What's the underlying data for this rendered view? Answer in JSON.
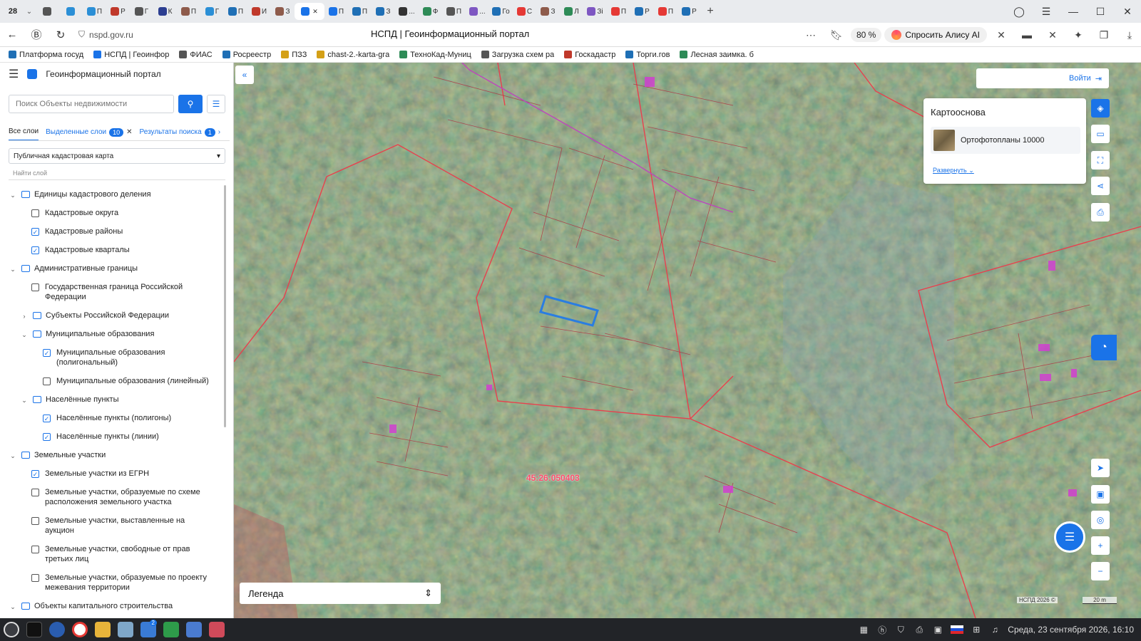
{
  "browser": {
    "tab_count": "28",
    "tabs": [
      {
        "label": "",
        "color": "#555"
      },
      {
        "label": "",
        "color": "#2b8fd6"
      },
      {
        "label": "П",
        "color": "#2b8fd6"
      },
      {
        "label": "Р",
        "color": "#c0392b"
      },
      {
        "label": "Г",
        "color": "#555"
      },
      {
        "label": "К",
        "color": "#2c3e91"
      },
      {
        "label": "П",
        "color": "#8e5b4b"
      },
      {
        "label": "Г",
        "color": "#2b8fd6"
      },
      {
        "label": "П",
        "color": "#1f6fb5"
      },
      {
        "label": "И",
        "color": "#c0392b"
      },
      {
        "label": "З",
        "color": "#8e5b4b"
      },
      {
        "label": "",
        "color": "#1a73e8",
        "active": true
      },
      {
        "label": "П",
        "color": "#1a73e8"
      },
      {
        "label": "П",
        "color": "#1f6fb5"
      },
      {
        "label": "З",
        "color": "#1f6fb5"
      },
      {
        "label": "...",
        "color": "#333"
      },
      {
        "label": "Ф",
        "color": "#2e8b57"
      },
      {
        "label": "П",
        "color": "#555"
      },
      {
        "label": "...",
        "color": "#7e57c2"
      },
      {
        "label": "Го",
        "color": "#1f6fb5"
      },
      {
        "label": "С",
        "color": "#e53935"
      },
      {
        "label": "З",
        "color": "#8e5b4b"
      },
      {
        "label": "Л",
        "color": "#2e8b57"
      },
      {
        "label": "Зі",
        "color": "#7e57c2"
      },
      {
        "label": "П",
        "color": "#e53935"
      },
      {
        "label": "Р",
        "color": "#1f6fb5"
      },
      {
        "label": "П",
        "color": "#e53935"
      },
      {
        "label": "Р",
        "color": "#1f6fb5"
      }
    ],
    "url": "nspd.gov.ru",
    "page_title": "НСПД | Геоинформационный портал",
    "zoom": "80 %",
    "alice": "Спросить Алису AI",
    "bookmarks": [
      {
        "label": "Платформа госуд",
        "color": "#1f6fb5"
      },
      {
        "label": "НСПД | Геоинфор",
        "color": "#1a73e8"
      },
      {
        "label": "ФИАС",
        "color": "#555"
      },
      {
        "label": "Росреестр",
        "color": "#1f6fb5"
      },
      {
        "label": "ПЗЗ",
        "color": "#d4a017"
      },
      {
        "label": "chast-2.-karta-gra",
        "color": "#d4a017"
      },
      {
        "label": "ТехноКад-Муниц",
        "color": "#2e8b57"
      },
      {
        "label": "Загрузка схем ра",
        "color": "#555"
      },
      {
        "label": "Госкадастр",
        "color": "#c0392b"
      },
      {
        "label": "Торги.гов",
        "color": "#1f6fb5"
      },
      {
        "label": "Лесная заимка. б",
        "color": "#2e8b57"
      }
    ]
  },
  "sidebar": {
    "title": "Геоинформационный портал",
    "search_placeholder": "Поиск Объекты недвижимости",
    "tabs": {
      "all": "Все слои",
      "selected": "Выделенные слои",
      "selected_count": "10",
      "results": "Результаты поиска",
      "results_count": "1"
    },
    "map_select": "Публичная кадастровая карта",
    "find_layer": "Найти слой",
    "tree": [
      {
        "type": "folder",
        "level": 0,
        "expanded": true,
        "label": "Единицы кадастрового деления"
      },
      {
        "type": "check",
        "level": 1,
        "checked": false,
        "label": "Кадастровые округа"
      },
      {
        "type": "check",
        "level": 1,
        "checked": true,
        "label": "Кадастровые районы"
      },
      {
        "type": "check",
        "level": 1,
        "checked": true,
        "label": "Кадастровые кварталы"
      },
      {
        "type": "folder",
        "level": 0,
        "expanded": true,
        "label": "Административные границы"
      },
      {
        "type": "check",
        "level": 1,
        "checked": false,
        "label": "Государственная граница Российской Федерации"
      },
      {
        "type": "folder",
        "level": 1,
        "expanded": false,
        "label": "Субъекты Российской Федерации"
      },
      {
        "type": "folder",
        "level": 1,
        "expanded": true,
        "label": "Муниципальные образования"
      },
      {
        "type": "check",
        "level": 2,
        "checked": true,
        "label": "Муниципальные образования (полигональный)"
      },
      {
        "type": "check",
        "level": 2,
        "checked": false,
        "label": "Муниципальные образования (линейный)"
      },
      {
        "type": "folder",
        "level": 1,
        "expanded": true,
        "label": "Населённые пункты"
      },
      {
        "type": "check",
        "level": 2,
        "checked": true,
        "label": "Населённые пункты (полигоны)"
      },
      {
        "type": "check",
        "level": 2,
        "checked": true,
        "label": "Населённые пункты (линии)"
      },
      {
        "type": "folder",
        "level": 0,
        "expanded": true,
        "label": "Земельные участки"
      },
      {
        "type": "check",
        "level": 1,
        "checked": true,
        "label": "Земельные участки из ЕГРН"
      },
      {
        "type": "check",
        "level": 1,
        "checked": false,
        "label": "Земельные участки, образуемые по схеме расположения земельного участка"
      },
      {
        "type": "check",
        "level": 1,
        "checked": false,
        "label": "Земельные участки, выставленные на аукцион"
      },
      {
        "type": "check",
        "level": 1,
        "checked": false,
        "label": "Земельные участки, свободные от прав третьих лиц"
      },
      {
        "type": "check",
        "level": 1,
        "checked": false,
        "label": "Земельные участки, образуемые по проекту межевания территории"
      },
      {
        "type": "folder",
        "level": 0,
        "expanded": true,
        "label": "Объекты капитального строительства"
      }
    ]
  },
  "map": {
    "login": "Войти",
    "basemap_title": "Картооснова",
    "basemap_item": "Ортофотопланы 10000",
    "basemap_expand": "Развернуть",
    "legend": "Легенда",
    "cadastral_label": "45:26:050403",
    "copyright": "НСПД 2026 ©",
    "scale": "20 m",
    "colors": {
      "boundary": "#e8404e",
      "selection": "#2a7de1",
      "accent": "#1a73e8"
    }
  },
  "taskbar": {
    "datetime": "Среда, 23 сентября 2026, 16:10",
    "badge": "2"
  }
}
